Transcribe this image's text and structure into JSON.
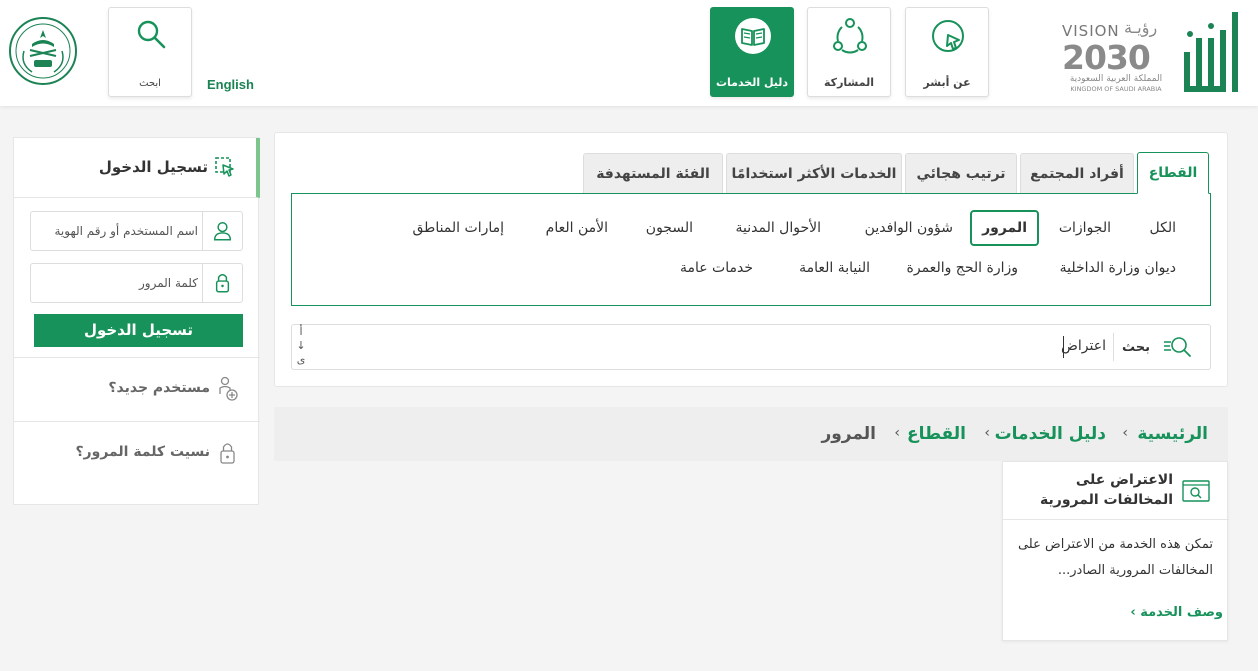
{
  "header": {
    "vision": {
      "word": "VISION",
      "ar": "رؤيـة",
      "year": "2030",
      "ksa_ar": "المملكة العربية السعودية",
      "ksa_en": "KINGDOM OF SAUDI ARABIA"
    },
    "nav": {
      "about": "عن أبشر",
      "participation": "المشاركة",
      "services_guide": "دليل الخدمات"
    },
    "language": "English",
    "search_label": "ابحث"
  },
  "login": {
    "title": "تسجيل الدخول",
    "username_placeholder": "اسم المستخدم أو رقم الهوية",
    "password_placeholder": "كلمة المرور",
    "submit_label": "تسجيل الدخول",
    "new_user": "مستخدم جديد؟",
    "forgot_password": "نسيت كلمة المرور؟"
  },
  "tabs": [
    "القطاع",
    "أفراد المجتمع",
    "ترتيب هجائي",
    "الخدمات الأكثر استخدامًا",
    "الفئة المستهدفة"
  ],
  "sectors": [
    "الكل",
    "الجوازات",
    "المرور",
    "شؤون الوافدين",
    "الأحوال المدنية",
    "السجون",
    "الأمن العام",
    "إمارات المناطق",
    "ديوان وزارة الداخلية",
    "وزارة الحج والعمرة",
    "النيابة العامة",
    "خدمات عامة"
  ],
  "search": {
    "button_label": "بحث",
    "value": "اعتراض",
    "sort_label": "أ ↓ ى"
  },
  "breadcrumb": [
    "الرئيسية",
    "دليل الخدمات",
    "القطاع",
    "المرور"
  ],
  "service_card": {
    "title": "الاعتراض على المخالفات المرورية",
    "description": "تمكن هذه الخدمة من الاعتراض على المخالفات المرورية الصادر...",
    "more_label": "وصف الخدمة ›"
  },
  "colors": {
    "brand": "#17925a",
    "accent_border": "#7ec48d"
  }
}
